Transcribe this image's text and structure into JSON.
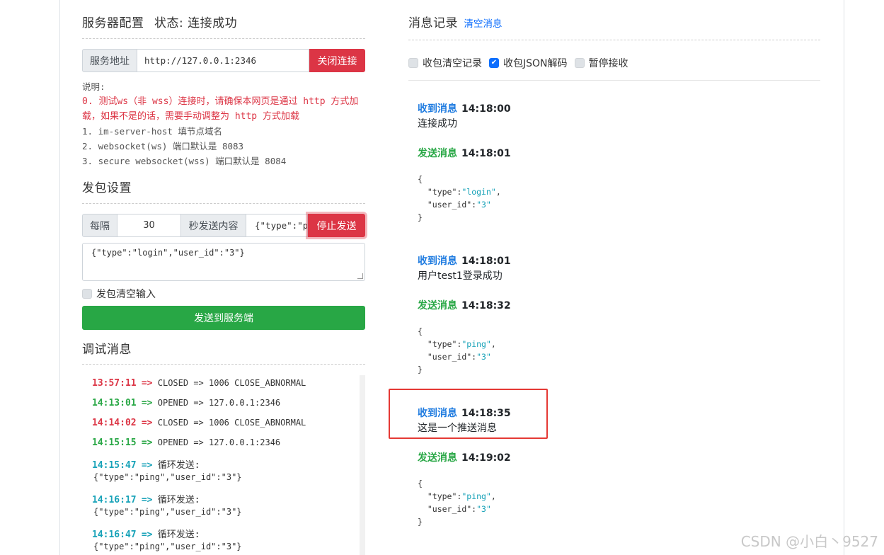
{
  "server": {
    "title": "服务器配置",
    "status": "状态: 连接成功",
    "address_label": "服务地址",
    "address_value": "http://127.0.0.1:2346",
    "close_button": "关闭连接"
  },
  "notes": {
    "heading": "说明:",
    "warn_line1": "0. 测试ws（非 wss）连接时，请确保本网页是通过 http 方式加",
    "warn_line2": "载，如果不是的话，需要手动调整为 http 方式加载",
    "line1": "1. im-server-host 填节点域名",
    "line2": "2. websocket(ws) 端口默认是 8083",
    "line3": "3. secure websocket(wss) 端口默认是 8084"
  },
  "send_settings": {
    "title": "发包设置",
    "every_label": "每隔",
    "interval_value": "30",
    "content_label": "秒发送内容",
    "content_value": "{\"type\":\"p",
    "stop_button": "停止发送",
    "textarea_value": "{\"type\":\"login\",\"user_id\":\"3\"}",
    "clear_input_label": "发包清空输入",
    "send_button": "发送到服务端"
  },
  "debug": {
    "title": "调试消息",
    "lines": [
      {
        "time": "13:57:11",
        "arrow": "=>",
        "text": "CLOSED => 1006 CLOSE_ABNORMAL",
        "extra": ""
      },
      {
        "time": "14:13:01",
        "arrow": "=>",
        "text": "OPENED => 127.0.0.1:2346",
        "extra": ""
      },
      {
        "time": "14:14:02",
        "arrow": "=>",
        "text": "CLOSED => 1006 CLOSE_ABNORMAL",
        "extra": ""
      },
      {
        "time": "14:15:15",
        "arrow": "=>",
        "text": "OPENED => 127.0.0.1:2346",
        "extra": ""
      },
      {
        "time": "14:15:47",
        "arrow": "=>",
        "text": "循环发送:",
        "extra": "{\"type\":\"ping\",\"user_id\":\"3\"}"
      },
      {
        "time": "14:16:17",
        "arrow": "=>",
        "text": "循环发送:",
        "extra": "{\"type\":\"ping\",\"user_id\":\"3\"}"
      },
      {
        "time": "14:16:47",
        "arrow": "=>",
        "text": "循环发送:",
        "extra": "{\"type\":\"ping\",\"user_id\":\"3\"}"
      }
    ]
  },
  "messages": {
    "title": "消息记录",
    "clear_link": "清空消息",
    "opt_clear": "收包清空记录",
    "opt_json": "收包JSON解码",
    "opt_pause": "暂停接收",
    "items": [
      {
        "label": "收到消息",
        "time": "14:18:00",
        "text": "连接成功"
      },
      {
        "label": "发送消息",
        "time": "14:18:01",
        "json_open": "{",
        "k1": "\"type\"",
        "v1": "\"login\"",
        "k2": "\"user_id\"",
        "v2": "\"3\"",
        "json_close": "}"
      },
      {
        "label": "收到消息",
        "time": "14:18:01",
        "text": "用户test1登录成功"
      },
      {
        "label": "发送消息",
        "time": "14:18:32",
        "json_open": "{",
        "k1": "\"type\"",
        "v1": "\"ping\"",
        "k2": "\"user_id\"",
        "v2": "\"3\"",
        "json_close": "}"
      },
      {
        "label": "收到消息",
        "time": "14:18:35",
        "text": "这是一个推送消息"
      },
      {
        "label": "发送消息",
        "time": "14:19:02",
        "json_open": "{",
        "k1": "\"type\"",
        "v1": "\"ping\"",
        "k2": "\"user_id\"",
        "v2": "\"3\"",
        "json_close": "}"
      }
    ]
  },
  "watermark": "CSDN @小白丶9527",
  "colors": {
    "danger": "#dc3545",
    "success": "#28a745",
    "primary": "#0d6efd",
    "info": "#17a2b8"
  }
}
